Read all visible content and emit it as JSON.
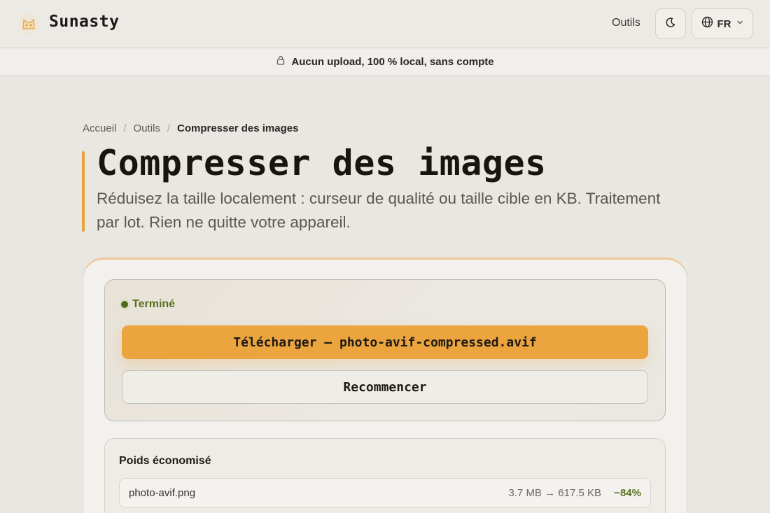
{
  "header": {
    "brand": "Sunasty",
    "nav_tools": "Outils",
    "lang_label": "FR"
  },
  "banner": {
    "text": "Aucun upload, 100 % local, sans compte"
  },
  "breadcrumb": {
    "items": [
      "Accueil",
      "Outils",
      "Compresser des images"
    ],
    "separator": "/"
  },
  "hero": {
    "title": "Compresser des images",
    "subtitle": "Réduisez la taille localement : curseur de qualité ou taille cible en KB. Traitement par lot. Rien ne quitte votre appareil."
  },
  "result": {
    "status": "Terminé",
    "download_label": "Télécharger — photo-avif-compressed.avif",
    "restart_label": "Recommencer"
  },
  "savings": {
    "title": "Poids économisé",
    "files": [
      {
        "name": "photo-avif.png",
        "sizes": "3.7 MB → 617.5 KB",
        "percent": "−84%"
      }
    ]
  },
  "colors": {
    "accent": "#eba43e",
    "success": "#5a6e1e",
    "background": "#e9e7e2"
  },
  "icons": [
    "cat-logo-icon",
    "moon-icon",
    "globe-icon",
    "chevron-down-icon",
    "lock-icon"
  ]
}
